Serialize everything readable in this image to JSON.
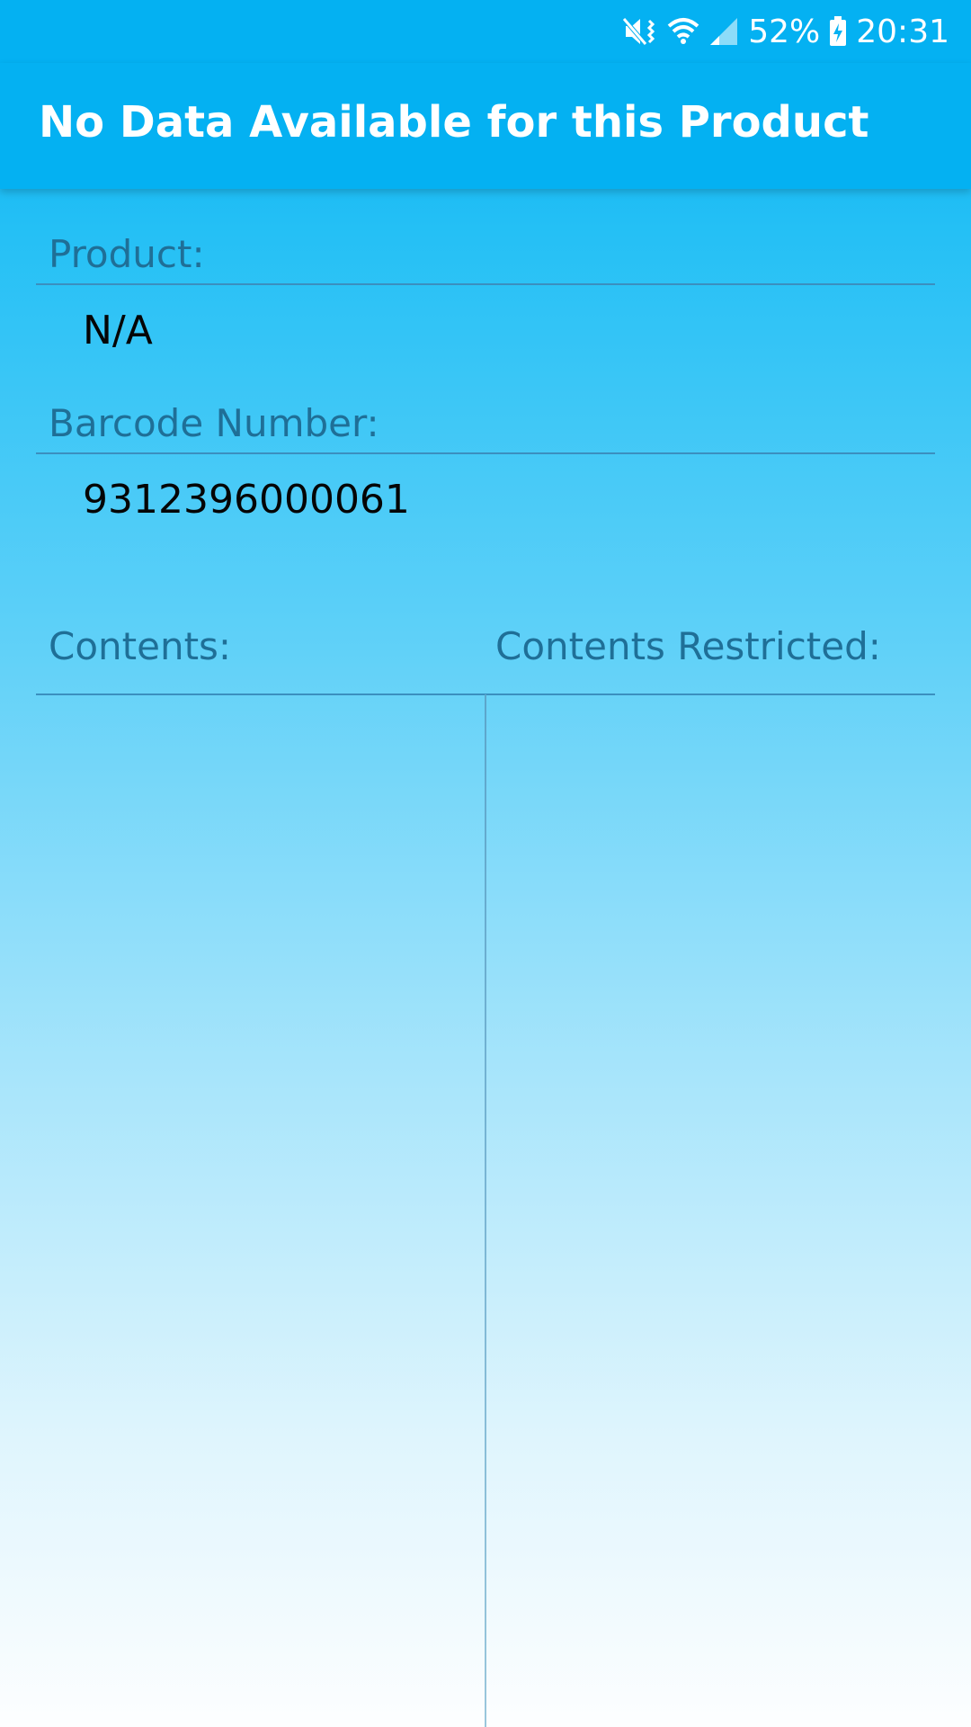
{
  "status_bar": {
    "battery": "52%",
    "time": "20:31",
    "icons": [
      "mute-vibrate-icon",
      "wifi-icon",
      "signal-icon",
      "battery-charging-icon"
    ]
  },
  "app_bar": {
    "title": "No Data Available for this Product"
  },
  "product": {
    "label": "Product:",
    "value": "N/A"
  },
  "barcode": {
    "label": "Barcode Number:",
    "value": "9312396000061"
  },
  "contents": {
    "label": "Contents:"
  },
  "contents_restricted": {
    "label": "Contents Restricted:"
  },
  "colors": {
    "app_bar": "#04b1f2",
    "label_text": "#1f6f97",
    "value_text": "#050505",
    "divider": "#3b8fbf"
  }
}
